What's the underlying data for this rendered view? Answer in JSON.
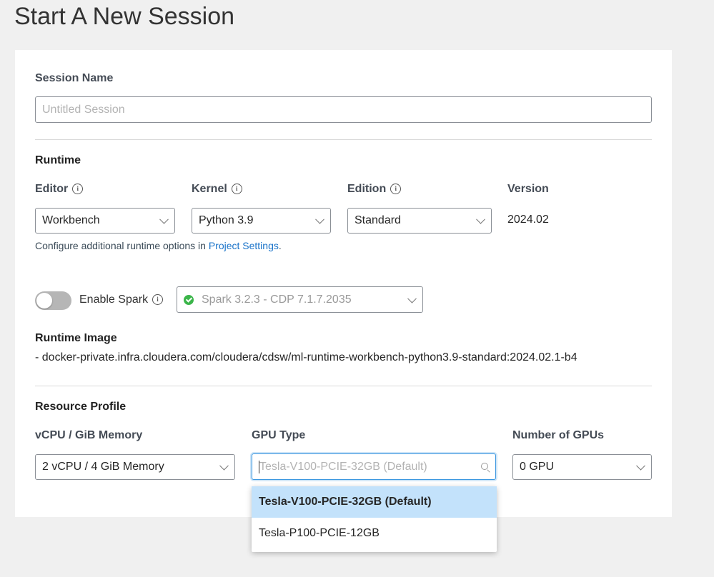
{
  "page": {
    "title": "Start A New Session"
  },
  "session_name": {
    "label": "Session Name",
    "placeholder": "Untitled Session",
    "value": ""
  },
  "runtime": {
    "heading": "Runtime",
    "editor": {
      "label": "Editor",
      "value": "Workbench"
    },
    "kernel": {
      "label": "Kernel",
      "value": "Python 3.9"
    },
    "edition": {
      "label": "Edition",
      "value": "Standard"
    },
    "version": {
      "label": "Version",
      "value": "2024.02"
    },
    "hint_text": "Configure additional runtime options in ",
    "hint_link": "Project Settings",
    "hint_end": "."
  },
  "spark": {
    "toggle_label": "Enable Spark",
    "enabled": false,
    "value": "Spark 3.2.3 - CDP 7.1.7.2035"
  },
  "runtime_image": {
    "heading": "Runtime Image",
    "value": "- docker-private.infra.cloudera.com/cloudera/cdsw/ml-runtime-workbench-python3.9-standard:2024.02.1-b4"
  },
  "resource_profile": {
    "heading": "Resource Profile",
    "cpu": {
      "label": "vCPU / GiB Memory",
      "value": "2 vCPU / 4 GiB Memory"
    },
    "gpu_type": {
      "label": "GPU Type",
      "placeholder": "Tesla-V100-PCIE-32GB (Default)",
      "options": [
        "Tesla-V100-PCIE-32GB (Default)",
        "Tesla-P100-PCIE-12GB"
      ]
    },
    "gpu_count": {
      "label": "Number of GPUs",
      "value": "0 GPU"
    }
  },
  "colors": {
    "link": "#1a73c9",
    "focus": "#3c97e0",
    "option_highlight": "#c3e2fb",
    "spark_ok": "#3bb54a"
  }
}
